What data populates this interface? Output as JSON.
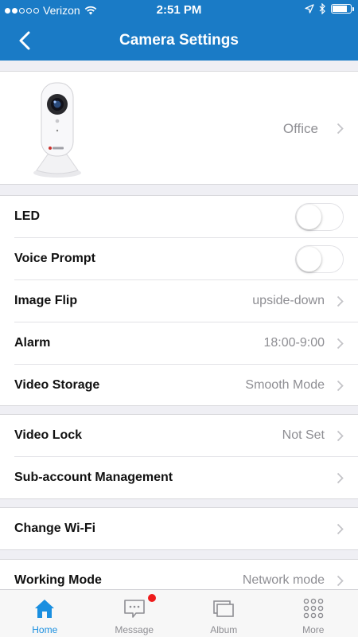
{
  "status_bar": {
    "carrier": "Verizon",
    "time": "2:51 PM",
    "signal_bars": 2,
    "battery_level": 0.85
  },
  "nav": {
    "title": "Camera Settings"
  },
  "device": {
    "name": "Office"
  },
  "settings_group_1": [
    {
      "label": "LED",
      "type": "toggle",
      "on": false
    },
    {
      "label": "Voice Prompt",
      "type": "toggle",
      "on": false
    },
    {
      "label": "Image Flip",
      "type": "link",
      "value": "upside-down"
    },
    {
      "label": "Alarm",
      "type": "link",
      "value": "18:00-9:00"
    },
    {
      "label": "Video Storage",
      "type": "link",
      "value": "Smooth Mode"
    }
  ],
  "settings_group_2": [
    {
      "label": "Video Lock",
      "value": "Not Set"
    },
    {
      "label": "Sub-account Management",
      "value": ""
    }
  ],
  "settings_group_3": [
    {
      "label": "Change Wi-Fi",
      "value": ""
    }
  ],
  "settings_group_4": [
    {
      "label": "Working Mode",
      "value": "Network mode"
    }
  ],
  "tabs": [
    {
      "label": "Home",
      "icon": "home-icon",
      "active": true
    },
    {
      "label": "Message",
      "icon": "message-icon",
      "active": false,
      "badge": true
    },
    {
      "label": "Album",
      "icon": "album-icon",
      "active": false
    },
    {
      "label": "More",
      "icon": "more-icon",
      "active": false
    }
  ],
  "colors": {
    "brand": "#1a7bc6",
    "active_tab": "#1a8fe0",
    "badge": "#ee1b1b"
  }
}
